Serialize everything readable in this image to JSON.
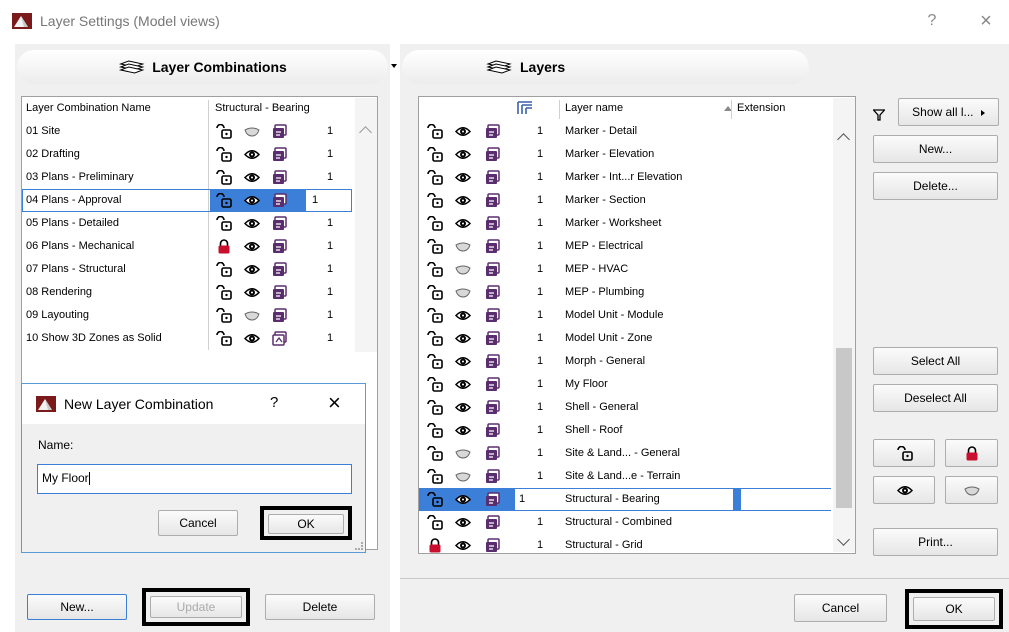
{
  "window": {
    "title": "Layer Settings (Model views)",
    "help": "?",
    "close": "×"
  },
  "left": {
    "header": "Layer Combinations",
    "col_name": "Layer Combination Name",
    "col_state": "Structural - Bearing",
    "rows": [
      {
        "name": "01 Site",
        "lock": false,
        "visible": false,
        "num": "1"
      },
      {
        "name": "02 Drafting",
        "lock": false,
        "visible": true,
        "num": "1"
      },
      {
        "name": "03 Plans - Preliminary",
        "lock": false,
        "visible": true,
        "num": "1"
      },
      {
        "name": "04 Plans - Approval",
        "lock": false,
        "visible": true,
        "num": "1"
      },
      {
        "name": "05 Plans - Detailed",
        "lock": false,
        "visible": true,
        "num": "1"
      },
      {
        "name": "06 Plans - Mechanical",
        "lock": true,
        "visible": true,
        "num": "1"
      },
      {
        "name": "07 Plans - Structural",
        "lock": false,
        "visible": true,
        "num": "1"
      },
      {
        "name": "08 Rendering",
        "lock": false,
        "visible": true,
        "num": "1"
      },
      {
        "name": "09 Layouting",
        "lock": false,
        "visible": false,
        "num": "1"
      },
      {
        "name": "10 Show 3D Zones as Solid",
        "lock": false,
        "visible": true,
        "num": "1"
      }
    ],
    "new_label": "New...",
    "update_label": "Update",
    "delete_label": "Delete"
  },
  "dialog": {
    "title": "New Layer Combination",
    "help": "?",
    "close": "×",
    "name_label": "Name:",
    "name_value": "My Floor",
    "cancel_label": "Cancel",
    "ok_label": "OK"
  },
  "right": {
    "header": "Layers",
    "col_name": "Layer name",
    "col_ext": "Extension",
    "rows": [
      {
        "name": "Marker - Detail",
        "lock": false,
        "visible": true,
        "num": "1"
      },
      {
        "name": "Marker - Elevation",
        "lock": false,
        "visible": true,
        "num": "1"
      },
      {
        "name": "Marker - Int...r Elevation",
        "lock": false,
        "visible": true,
        "num": "1"
      },
      {
        "name": "Marker - Section",
        "lock": false,
        "visible": true,
        "num": "1"
      },
      {
        "name": "Marker - Worksheet",
        "lock": false,
        "visible": true,
        "num": "1"
      },
      {
        "name": "MEP - Electrical",
        "lock": false,
        "visible": false,
        "num": "1"
      },
      {
        "name": "MEP - HVAC",
        "lock": false,
        "visible": false,
        "num": "1"
      },
      {
        "name": "MEP - Plumbing",
        "lock": false,
        "visible": false,
        "num": "1"
      },
      {
        "name": "Model Unit - Module",
        "lock": false,
        "visible": true,
        "num": "1"
      },
      {
        "name": "Model Unit - Zone",
        "lock": false,
        "visible": true,
        "num": "1"
      },
      {
        "name": "Morph - General",
        "lock": false,
        "visible": true,
        "num": "1"
      },
      {
        "name": "My Floor",
        "lock": false,
        "visible": true,
        "num": "1"
      },
      {
        "name": "Shell - General",
        "lock": false,
        "visible": true,
        "num": "1"
      },
      {
        "name": "Shell - Roof",
        "lock": false,
        "visible": true,
        "num": "1"
      },
      {
        "name": "Site & Land... - General",
        "lock": false,
        "visible": false,
        "num": "1"
      },
      {
        "name": "Site & Land...e - Terrain",
        "lock": false,
        "visible": false,
        "num": "1"
      },
      {
        "name": "Structural - Bearing",
        "lock": false,
        "visible": true,
        "num": "1"
      },
      {
        "name": "Structural - Combined",
        "lock": false,
        "visible": true,
        "num": "1"
      },
      {
        "name": "Structural - Grid",
        "lock": true,
        "visible": true,
        "num": "1"
      }
    ],
    "show_all_label": "Show all l...",
    "new_label": "New...",
    "delete_label": "Delete...",
    "select_all_label": "Select All",
    "deselect_all_label": "Deselect All",
    "print_label": "Print...",
    "cancel_label": "Cancel",
    "ok_label": "OK"
  },
  "colors": {
    "selection": "#3b7fd9",
    "lock_red": "#c8102e",
    "layer_purple": "#5a2d6e"
  }
}
